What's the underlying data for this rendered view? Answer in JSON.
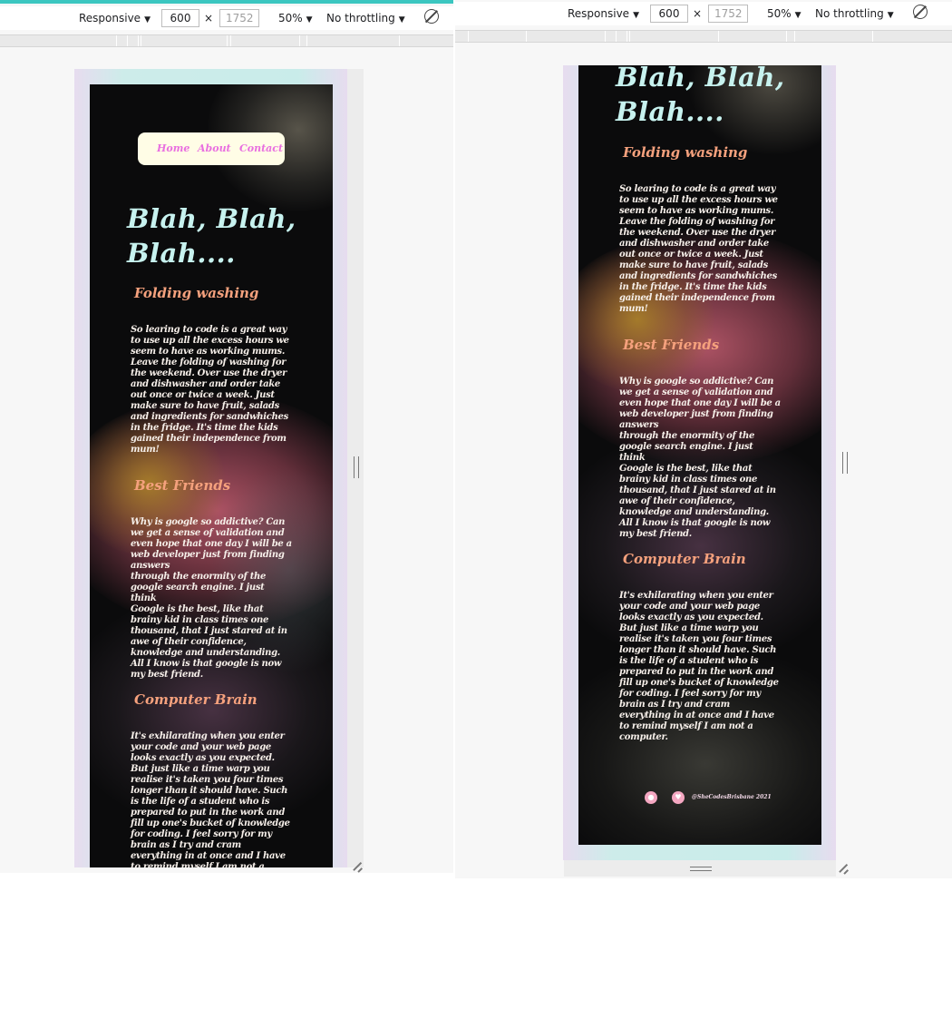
{
  "toolbar": {
    "device_mode": "Responsive",
    "width": "600",
    "dimension_separator": "×",
    "height": "1752",
    "zoom": "50%",
    "throttling": "No throttling",
    "caret": "▼"
  },
  "site": {
    "nav": {
      "home": "Home",
      "about": "About",
      "contact": "Contact"
    },
    "hero_line1": "Blah, Blah,",
    "hero_line2": "Blah....",
    "sections": [
      {
        "title": "Folding washing",
        "lines": [
          "So learing to code is a great way",
          "to use up all the excess hours we",
          "seem to have as working mums.",
          "Leave the folding of washing for",
          "the weekend. Over use the dryer",
          "and dishwasher and order take",
          "out once or twice a week. Just",
          "make sure to have fruit, salads",
          "and ingredients for sandwhiches",
          "in the fridge. It's time the kids",
          "gained their independence from",
          "mum!"
        ]
      },
      {
        "title": "Best Friends",
        "lines": [
          "Why is google so addictive? Can",
          "we get a sense of validation and",
          "even hope that one day I will be a",
          "web developer just from finding",
          "answers",
          "through the enormity of the",
          "google search engine. I just think",
          "Google is the best, like that",
          "brainy kid in class times one",
          "thousand, that I just stared at in",
          "awe of their confidence,",
          "knowledge and understanding.",
          "All I know is that google is now",
          "my best friend."
        ]
      },
      {
        "title": "Computer Brain",
        "lines": [
          "It's exhilarating when you enter",
          "your code and your web page",
          "looks exactly as you expected.",
          "But just like a time warp you",
          "realise it's taken you four times",
          "longer than it should have. Such",
          "is the life of a student who is",
          "prepared to put in the work and",
          "fill up one's bucket of knowledge",
          "for coding. I feel sorry for my",
          "brain as I try and cram",
          "everything in at once and I have",
          "to remind myself I am not a",
          "computer."
        ]
      }
    ],
    "footer": {
      "github_icon": "github-icon",
      "heart_icon": "heart-icon",
      "credit": "@SheCodesBrisbane 2021"
    }
  },
  "colors": {
    "accent": "#3bc6c0",
    "nav_bg": "#fffde6",
    "nav_link": "#e96fe0",
    "hero": "#c7f2ef",
    "section_title": "#f5a17d",
    "body_text": "#f6efe9"
  }
}
